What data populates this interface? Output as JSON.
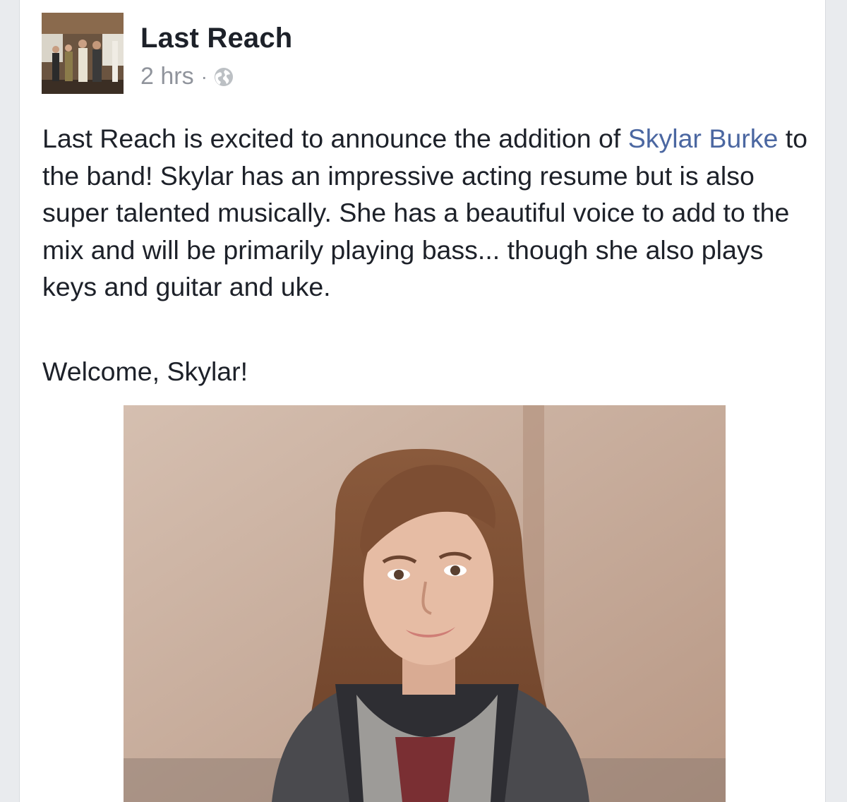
{
  "post": {
    "page_name": "Last Reach",
    "timestamp": "2 hrs",
    "separator": "·",
    "privacy_icon": "globe-icon",
    "body_intro": "Last Reach is excited to announce the addition of ",
    "mention": "Skylar Burke",
    "body_rest": " to the band! Skylar has an impressive acting resume but is also super talented musically. She has a beautiful voice to add to the mix and will be primarily playing bass... though she also plays keys and guitar and uke.",
    "welcome": "Welcome, Skylar!",
    "avatar_icon": "band-group-photo",
    "photo_icon": "portrait-photo"
  },
  "colors": {
    "background": "#e9ebee",
    "card": "#ffffff",
    "text": "#1d2129",
    "meta": "#90949c",
    "link": "#4b67a1"
  }
}
